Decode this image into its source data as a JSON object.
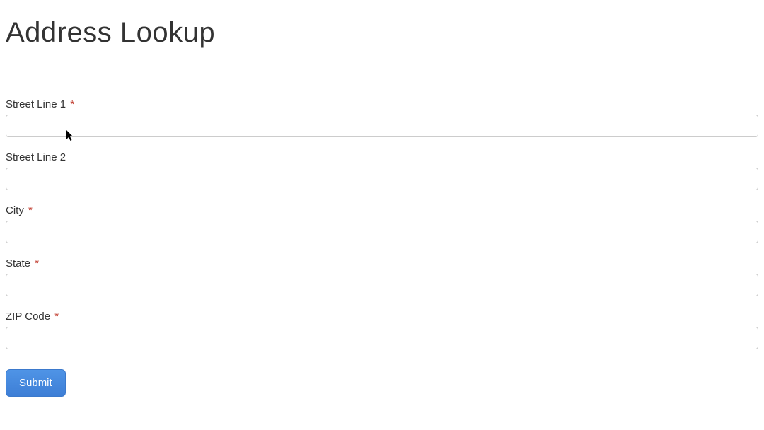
{
  "page": {
    "title": "Address Lookup"
  },
  "form": {
    "street1": {
      "label": "Street Line 1",
      "required_mark": "*",
      "value": ""
    },
    "street2": {
      "label": "Street Line 2",
      "value": ""
    },
    "city": {
      "label": "City",
      "required_mark": "*",
      "value": ""
    },
    "state": {
      "label": "State",
      "required_mark": "*",
      "value": ""
    },
    "zip": {
      "label": "ZIP Code",
      "required_mark": "*",
      "value": ""
    },
    "submit_label": "Submit"
  }
}
